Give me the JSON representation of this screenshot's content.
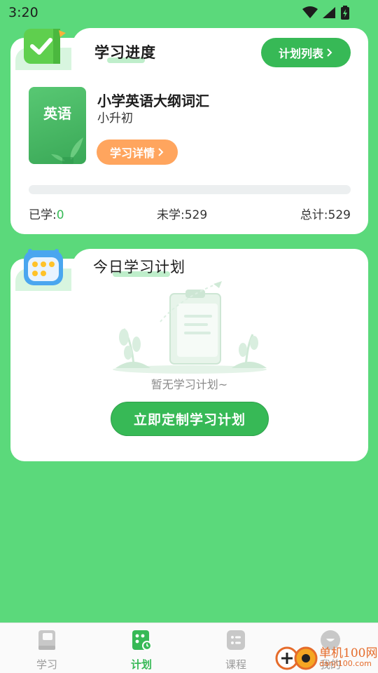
{
  "status_bar": {
    "time": "3:20"
  },
  "progress_card": {
    "title": "学习进度",
    "plan_list_label": "计划列表",
    "book": {
      "cover_label": "英语",
      "title": "小学英语大纲词汇",
      "subtitle": "小升初",
      "detail_label": "学习详情"
    },
    "progress_fraction": 0,
    "stats": {
      "learned_label": "已学:",
      "learned_value": "0",
      "unlearned_label": "未学:",
      "unlearned_value": "529",
      "total_label": "总计:",
      "total_value": "529"
    }
  },
  "today_card": {
    "title": "今日学习计划",
    "empty_text": "暂无学习计划~",
    "make_plan_label": "立即定制学习计划"
  },
  "bottom_nav": {
    "items": [
      {
        "label": "学习",
        "icon": "book-icon",
        "active": false
      },
      {
        "label": "计划",
        "icon": "calendar-icon",
        "active": true
      },
      {
        "label": "课程",
        "icon": "course-icon",
        "active": false
      },
      {
        "label": "我的",
        "icon": "profile-icon",
        "active": false
      }
    ]
  },
  "watermark": {
    "text": "单机100网",
    "sub": "danji100.com"
  },
  "colors": {
    "background": "#5bd97b",
    "accent": "#37b956",
    "orange": "#ffa55e"
  }
}
